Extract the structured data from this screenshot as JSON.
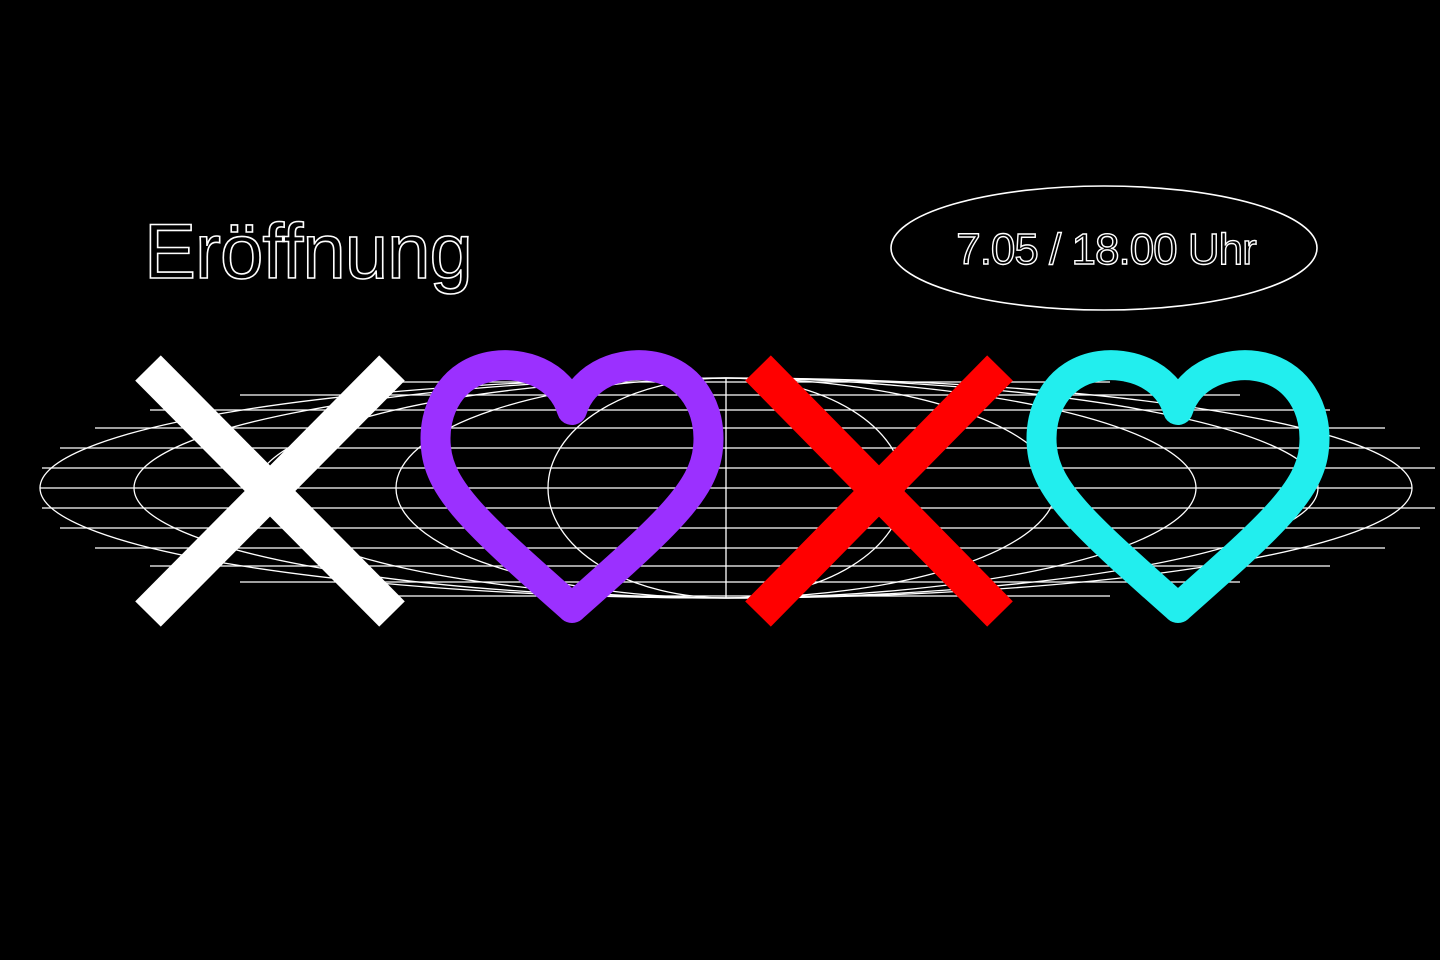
{
  "poster": {
    "title": "Eröffnung",
    "date_time": "7.05 / 18.00 Uhr",
    "symbols": [
      {
        "kind": "x",
        "color": "#ffffff"
      },
      {
        "kind": "heart",
        "color": "#9b30ff"
      },
      {
        "kind": "x",
        "color": "#ff0000"
      },
      {
        "kind": "heart",
        "color": "#22eeee"
      }
    ],
    "colors": {
      "background": "#000000",
      "outline_text": "#ffffff",
      "wireframe": "#ffffff"
    },
    "icons": [
      "wireframe-globe-icon",
      "x-icon",
      "heart-icon"
    ]
  }
}
